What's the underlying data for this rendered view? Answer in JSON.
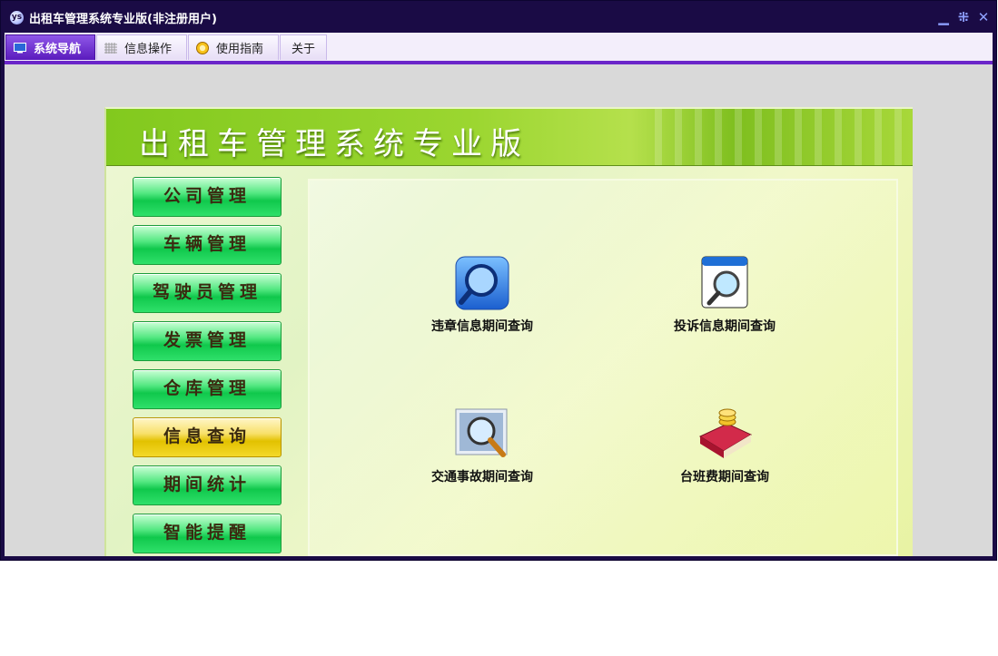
{
  "window": {
    "title": "出租车管理系统专业版(非注册用户)",
    "controls": [
      "minimize-icon",
      "restore-icon",
      "close-icon"
    ]
  },
  "menu": {
    "tabs": [
      {
        "label": "系统导航",
        "icon": "monitor-icon",
        "active": true
      },
      {
        "label": "信息操作",
        "icon": "grid-icon",
        "active": false
      },
      {
        "label": "使用指南",
        "icon": "help-disc-icon",
        "active": false
      },
      {
        "label": "关于",
        "icon": "",
        "active": false
      }
    ]
  },
  "banner": {
    "title": "出租车管理系统专业版"
  },
  "sidebar": {
    "items": [
      {
        "label": "公司管理",
        "active": false
      },
      {
        "label": "车辆管理",
        "active": false
      },
      {
        "label": "驾驶员管理",
        "active": false
      },
      {
        "label": "发票管理",
        "active": false
      },
      {
        "label": "仓库管理",
        "active": false
      },
      {
        "label": "信息查询",
        "active": true
      },
      {
        "label": "期间统计",
        "active": false
      },
      {
        "label": "智能提醒",
        "active": false
      }
    ]
  },
  "queries": [
    {
      "label": "违章信息期间查询",
      "icon": "magnifier-blue-icon"
    },
    {
      "label": "投诉信息期间查询",
      "icon": "magnifier-window-icon"
    },
    {
      "label": "交通事故期间查询",
      "icon": "magnifier-photo-icon"
    },
    {
      "label": "台班费期间查询",
      "icon": "coins-book-icon"
    }
  ],
  "colors": {
    "frame": "#1a0b45",
    "menu_accent": "#6a25c9",
    "nav_green": "#10c84c",
    "nav_active_yellow": "#e2c100",
    "banner_green": "#82c91e"
  }
}
